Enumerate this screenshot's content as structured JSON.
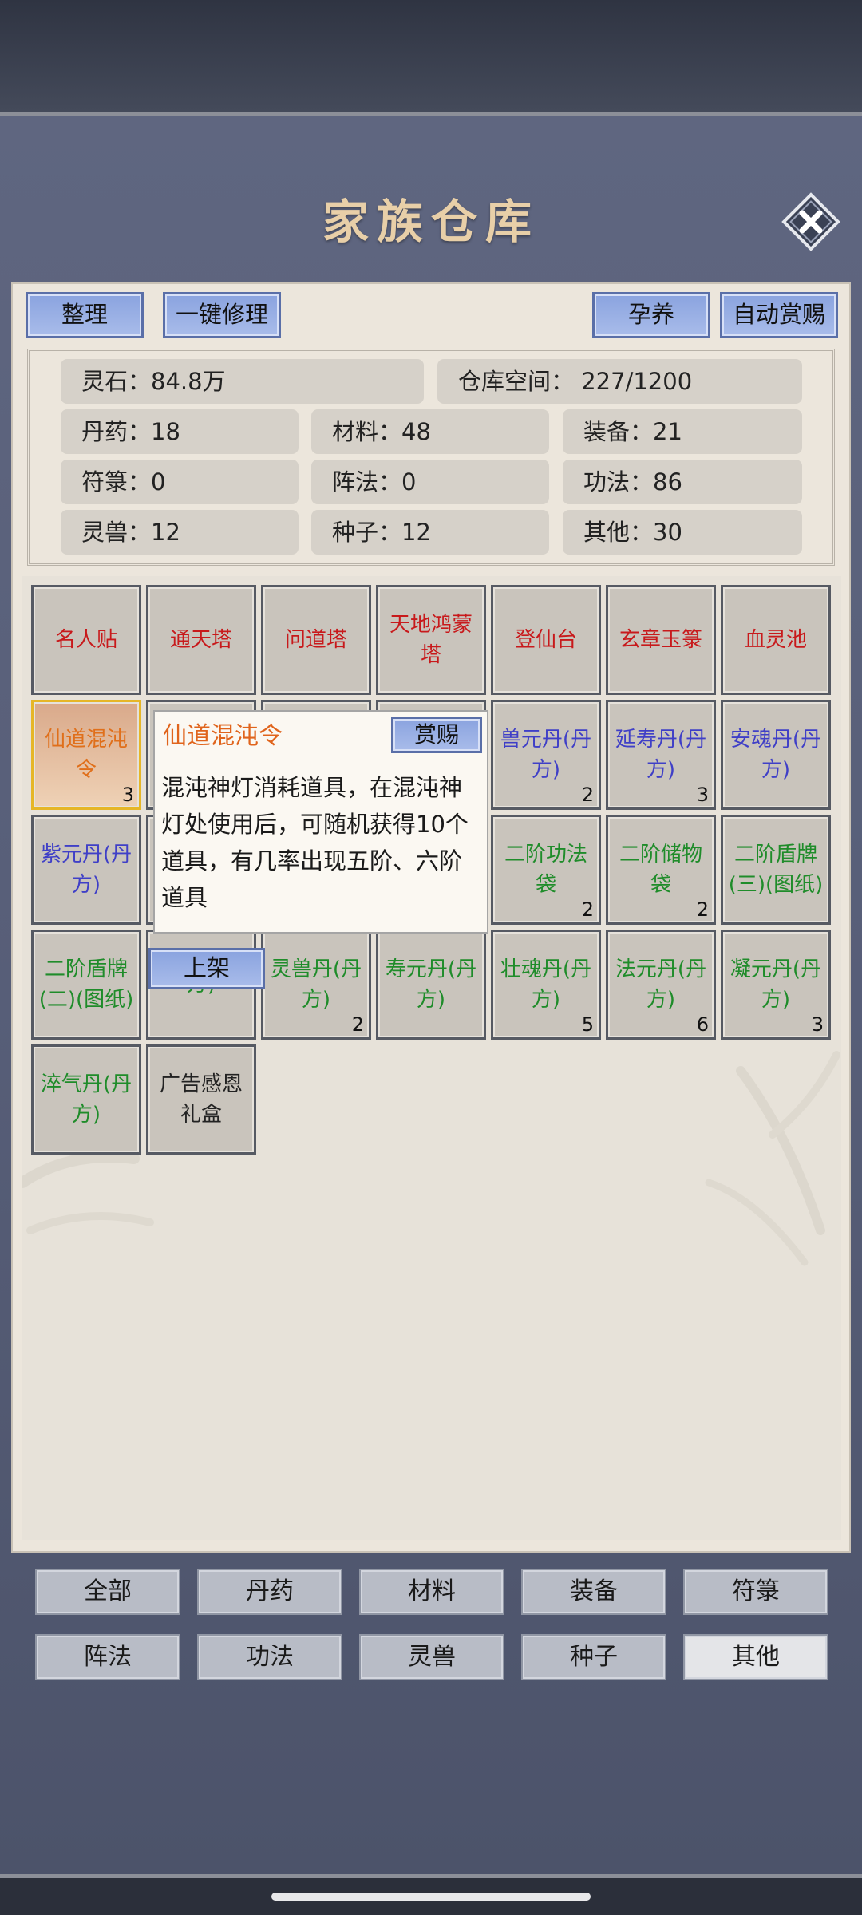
{
  "title": "家族仓库",
  "buttons": {
    "sort": "整理",
    "repair": "一键修理",
    "nurture": "孕养",
    "auto_reward": "自动赏赐"
  },
  "stats": {
    "spirit_stone": "灵石：84.8万",
    "storage": "仓库空间：   227/1200",
    "row2": [
      "丹药：18",
      "材料：48",
      "装备：21"
    ],
    "row3": [
      "符箓：0",
      "阵法：0",
      "功法：86"
    ],
    "row4": [
      "灵兽：12",
      "种子：12",
      "其他：30"
    ]
  },
  "items": [
    {
      "name": "名人贴",
      "color": "red",
      "count": ""
    },
    {
      "name": "通天塔",
      "color": "red",
      "count": ""
    },
    {
      "name": "问道塔",
      "color": "red",
      "count": ""
    },
    {
      "name": "天地鸿蒙塔",
      "color": "red",
      "count": ""
    },
    {
      "name": "登仙台",
      "color": "red",
      "count": ""
    },
    {
      "name": "玄章玉箓",
      "color": "red",
      "count": ""
    },
    {
      "name": "血灵池",
      "color": "red",
      "count": ""
    },
    {
      "name": "仙道混沌令",
      "color": "orange",
      "count": "3",
      "selected": true
    },
    {
      "name": "",
      "color": "blue",
      "count": ""
    },
    {
      "name": "",
      "color": "blue",
      "count": ""
    },
    {
      "name": "",
      "color": "blue",
      "count": ""
    },
    {
      "name": "兽元丹(丹方)",
      "color": "blue",
      "count": "2"
    },
    {
      "name": "延寿丹(丹方)",
      "color": "blue",
      "count": "3"
    },
    {
      "name": "安魂丹(丹方)",
      "color": "blue",
      "count": ""
    },
    {
      "name": "紫元丹(丹方)",
      "color": "blue",
      "count": ""
    },
    {
      "name": "",
      "color": "blue",
      "count": ""
    },
    {
      "name": "",
      "color": "blue",
      "count": ""
    },
    {
      "name": "",
      "color": "blue",
      "count": ""
    },
    {
      "name": "二阶功法袋",
      "color": "green",
      "count": "2"
    },
    {
      "name": "二阶储物袋",
      "color": "green",
      "count": "2"
    },
    {
      "name": "二阶盾牌(三)(图纸)",
      "color": "green",
      "count": ""
    },
    {
      "name": "二阶盾牌(二)(图纸)",
      "color": "green",
      "count": ""
    },
    {
      "name": "方)",
      "color": "green",
      "count": ""
    },
    {
      "name": "灵兽丹(丹方)",
      "color": "green",
      "count": "2"
    },
    {
      "name": "寿元丹(丹方)",
      "color": "green",
      "count": ""
    },
    {
      "name": "壮魂丹(丹方)",
      "color": "green",
      "count": "5"
    },
    {
      "name": "法元丹(丹方)",
      "color": "green",
      "count": "6"
    },
    {
      "name": "凝元丹(丹方)",
      "color": "green",
      "count": "3"
    },
    {
      "name": "淬气丹(丹方)",
      "color": "green",
      "count": ""
    },
    {
      "name": "广告感恩礼盒",
      "color": "black",
      "count": ""
    }
  ],
  "tooltip": {
    "title": "仙道混沌令",
    "reward_button": "赏赐",
    "description": "混沌神灯消耗道具，在混沌神灯处使用后，可随机获得10个道具，有几率出现五阶、六阶道具"
  },
  "list_button": "上架",
  "filters": [
    "全部",
    "丹药",
    "材料",
    "装备",
    "符箓",
    "阵法",
    "功法",
    "灵兽",
    "种子",
    "其他"
  ],
  "active_filter": "其他"
}
